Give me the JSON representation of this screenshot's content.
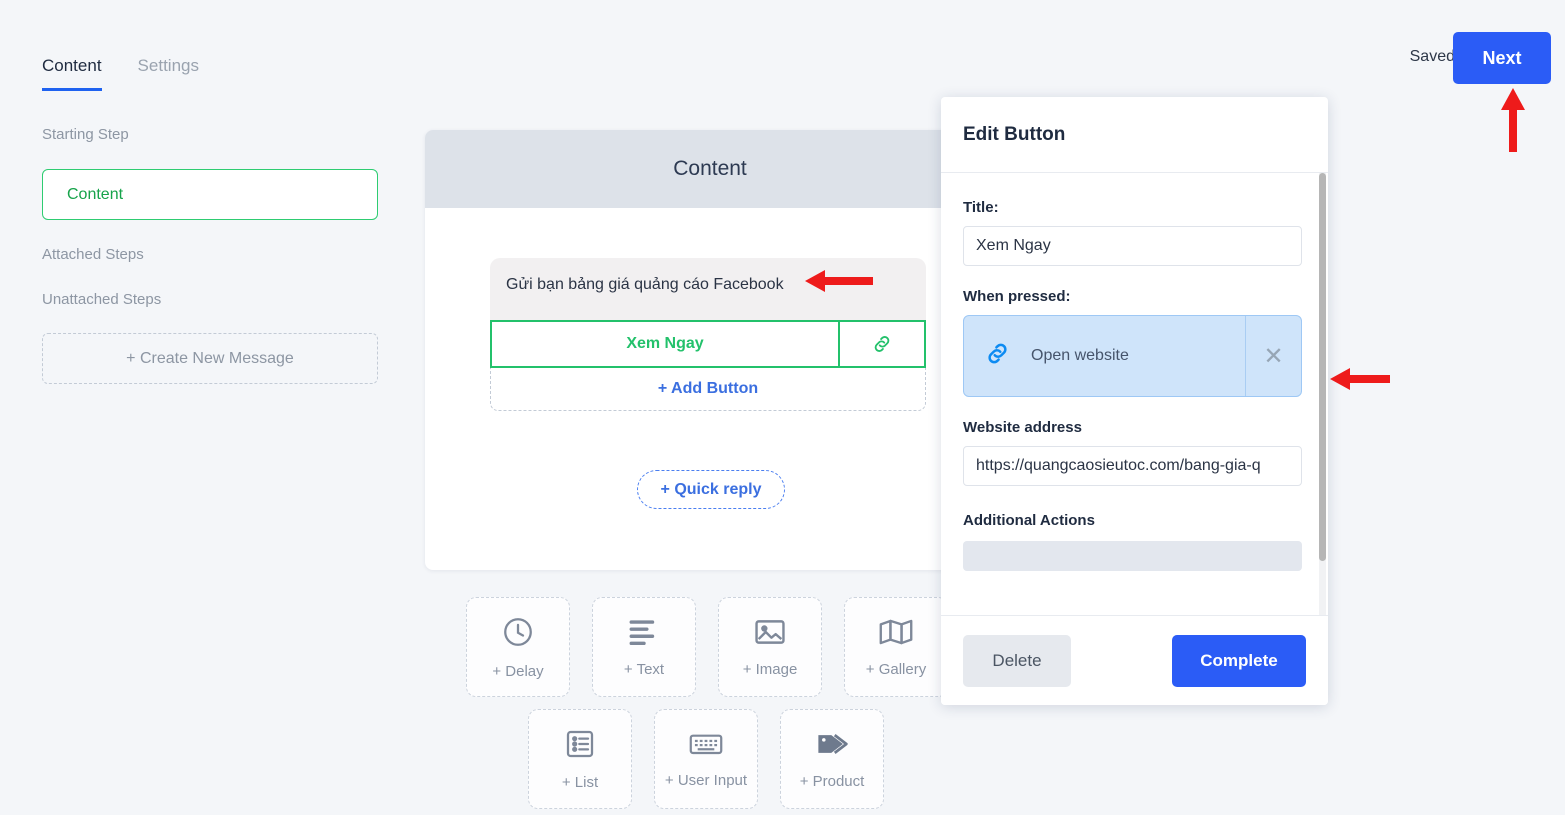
{
  "header": {
    "tabs": [
      {
        "label": "Content",
        "active": true
      },
      {
        "label": "Settings",
        "active": false
      }
    ],
    "saved_status": "Saved",
    "next_label": "Next",
    "accent_blue": "#2b5cf6",
    "accent_green": "#23c16b"
  },
  "sidebar": {
    "starting_step_label": "Starting Step",
    "step_name": "Content",
    "attached_label": "Attached Steps",
    "unattached_label": "Unattached Steps",
    "create_message_label": "+ Create New Message"
  },
  "message_card": {
    "header_title": "Content",
    "bubble_text": "Gửi bạn bảng giá quảng cáo Facebook",
    "button_label": "Xem Ngay",
    "button_icon": "link-icon",
    "add_button_label": "+ Add Button",
    "quick_reply_label": "+ Quick reply"
  },
  "tools": {
    "row1": [
      {
        "label": "+ Delay",
        "icon": "clock-icon"
      },
      {
        "label": "+ Text",
        "icon": "text-lines-icon"
      },
      {
        "label": "+ Image",
        "icon": "image-icon"
      },
      {
        "label": "+ Gallery",
        "icon": "gallery-map-icon"
      }
    ],
    "row2": [
      {
        "label": "+ List",
        "icon": "list-icon"
      },
      {
        "label": "+ User Input",
        "icon": "keyboard-icon"
      },
      {
        "label": "+ Product",
        "icon": "tag-icon"
      }
    ]
  },
  "edit_panel": {
    "title": "Edit Button",
    "title_field": {
      "label": "Title:",
      "value": "Xem Ngay"
    },
    "when_pressed": {
      "label": "When pressed:",
      "action": "Open website",
      "action_icon": "link-icon",
      "remove_icon": "close-icon"
    },
    "website": {
      "label": "Website address",
      "value": "https://quangcaosieutoc.com/bang-gia-q"
    },
    "additional_actions_label": "Additional Actions",
    "delete_label": "Delete",
    "complete_label": "Complete"
  },
  "annotations": {
    "arrow_color": "#ee1b1b",
    "arrows": [
      "points-at-bubble-text",
      "points-at-when-pressed-action",
      "points-at-next-button"
    ]
  }
}
